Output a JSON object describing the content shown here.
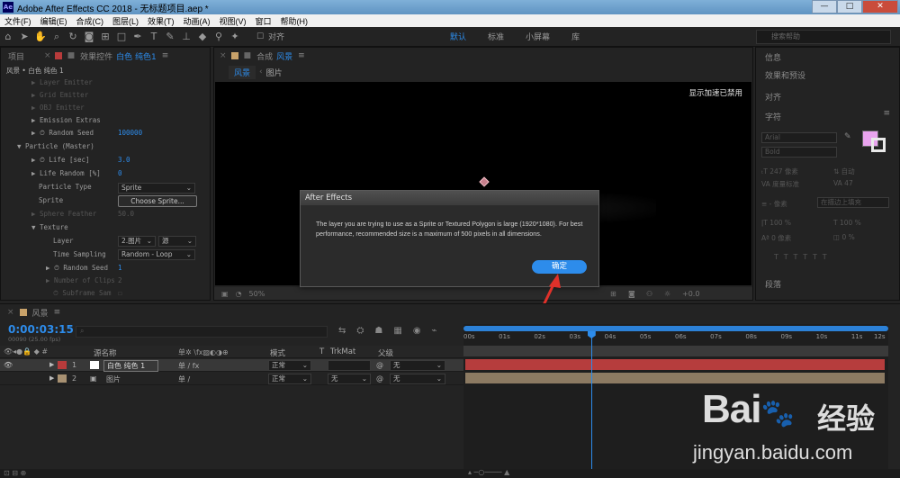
{
  "window": {
    "app_icon": "Ae",
    "title": "Adobe After Effects CC 2018 - 无标题项目.aep *",
    "controls": [
      "—",
      "□",
      "✕"
    ]
  },
  "menu": [
    "文件(F)",
    "编辑(E)",
    "合成(C)",
    "图层(L)",
    "效果(T)",
    "动画(A)",
    "视图(V)",
    "窗口",
    "帮助(H)"
  ],
  "toolbar": {
    "snap_label": "对齐",
    "workspaces": [
      "默认",
      "标准",
      "小屏幕",
      "库"
    ],
    "active_workspace": "默认",
    "search_placeholder": "搜索帮助"
  },
  "left_panel": {
    "tab_project": "项目",
    "tab_effects": "效果控件",
    "tab_effects_layer": "白色 纯色1",
    "breadcrumb": "风景 • 白色 纯色 1",
    "properties": [
      {
        "label": "Layer Emitter",
        "dim": true
      },
      {
        "label": "Grid Emitter",
        "dim": true
      },
      {
        "label": "OBJ Emitter",
        "dim": true
      },
      {
        "label": "Emission Extras",
        "dim": false
      },
      {
        "label": "Random Seed",
        "value": "100000"
      },
      {
        "label": "Particle (Master)"
      },
      {
        "label": "Life [sec]",
        "value": "3.0"
      },
      {
        "label": "Life Random [%]",
        "value": "0"
      },
      {
        "label": "Particle Type",
        "value": "Sprite"
      },
      {
        "label": "Sprite",
        "button": "Choose Sprite..."
      },
      {
        "label": "Sphere Feather",
        "value": "50.0",
        "dim": true
      },
      {
        "label": "Texture"
      },
      {
        "label": "Layer",
        "value": "2.图片",
        "value2": "源"
      },
      {
        "label": "Time Sampling",
        "value": "Random - Loop"
      },
      {
        "label": "Random Seed",
        "value": "1"
      },
      {
        "label": "Number of Clips",
        "value": "2",
        "dim": true
      },
      {
        "label": "Subframe Sam",
        "dim": true
      }
    ]
  },
  "viewer": {
    "tab_label": "合成",
    "tab_comp": "风景",
    "breadcrumb": [
      "风景",
      "图片"
    ],
    "gpu_notice": "显示加速已禁用",
    "zoom": "50%",
    "exposure": "+0.0"
  },
  "dialog": {
    "title": "After Effects",
    "message": "The layer you are trying to use as a Sprite or Textured Polygon is large (1920*1080). For best performance, recommended size is a maximum of 500 pixels in all dimensions.",
    "ok_label": "确定"
  },
  "right_panel": {
    "items": [
      "信息",
      "效果和预设",
      "对齐",
      "字符"
    ],
    "font": "Arial",
    "font_style": "Bold",
    "size": "247 像素",
    "leading": "自动",
    "kerning": "度量标准",
    "tracking": "47",
    "stroke": "- 像素",
    "stroke_mode": "在描边上填充",
    "scale_v": "100 %",
    "scale_h": "100 %",
    "baseline": "0 像素",
    "tsume": "0 %",
    "paragraph": "段落",
    "fill_color": "#e9a4ee"
  },
  "timeline": {
    "tab_label": "风景",
    "timecode": "0:00:03:15",
    "frame_info": "00090 (25.00 fps)",
    "col_source": "源名称",
    "col_mode": "模式",
    "col_t": "T",
    "col_trkmat": "TrkMat",
    "col_parent": "父级",
    "ruler": [
      "00s",
      "01s",
      "02s",
      "03s",
      "04s",
      "05s",
      "06s",
      "07s",
      "08s",
      "09s",
      "10s",
      "11s",
      "12s"
    ],
    "playhead_seconds": 3.62,
    "layers": [
      {
        "num": "1",
        "name": "白色 纯色 1",
        "mode": "正常",
        "trkmat": "",
        "parent": "无",
        "color": "#b83b3b",
        "bar_color": "#b63d3d"
      },
      {
        "num": "2",
        "name": "图片",
        "mode": "正常",
        "trkmat": "无",
        "parent": "无",
        "color": "#a89172",
        "bar_color": "#8c7a62"
      }
    ]
  },
  "watermark": {
    "brand": "Bai",
    "brand2": "经验",
    "url": "jingyan.baidu.com"
  }
}
